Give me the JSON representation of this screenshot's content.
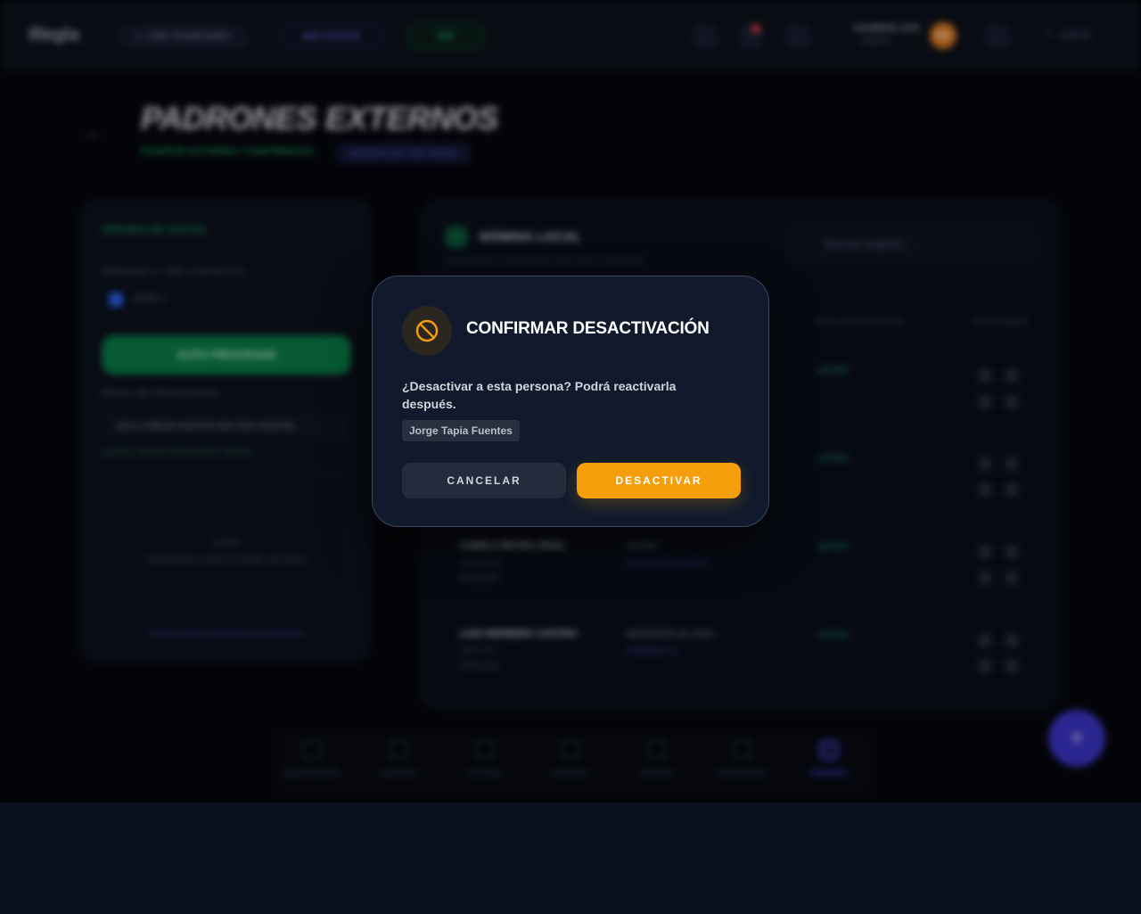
{
  "header": {
    "logo": "Illegla",
    "pill_1": "VER PADRONES",
    "pill_2": "MIS DATOS",
    "pill_3": "VIP",
    "user_name": "NOMBRE APE",
    "user_role": "ADMIN",
    "avatar_initials": "NA",
    "logout_label": "SALIR"
  },
  "page": {
    "title": "PADRONES EXTERNOS",
    "tag_1": "PADRÓN EXTERNO CONFIRMADO",
    "tag_2": "MODIFICAR VER NODO"
  },
  "left_panel": {
    "heading": "ORIGEN DE DATOS",
    "contact_label": "PERIODO O VER CONTACTO",
    "checkbox_label": "DATA 1",
    "primary_button": "AUTO PROCESAR",
    "section_label": "MODO DE PROCESADO",
    "select_value": "SOLO CREAR NUEVOS (NO PISA EXISTE)",
    "hint": "ALERTA: NUNCA PISAR DATOS VIEJOS.",
    "drop_title": "SUBIR",
    "drop_subtitle": "ARRASTRE O SELECCIONE ARCHIVO",
    "footer_link": "CONSULTAR FORMATO DE ARCHIVO"
  },
  "right_panel": {
    "title": "NÓMINA LOCAL",
    "subtitle": "PERSONAS CARGADAS EN ESTE PADRÓN",
    "search_placeholder": "Buscar registro...",
    "col_contacts": "VER CONTACTOS",
    "col_actions": "ACCIONES",
    "rows": [
      {
        "name": "",
        "id": "",
        "sub": "",
        "role": "",
        "link": "",
        "badge": "ACTIVO"
      },
      {
        "name": "",
        "id": "",
        "sub": "",
        "role": "",
        "link": "",
        "badge": "ACTIVO"
      },
      {
        "name": "CAMILA REYES VIDAL",
        "id": "10.442.983",
        "sub": "PERSONA",
        "role": "VECINO",
        "link": "REFERENTE BARRIO",
        "badge": "ACTIVO"
      },
      {
        "name": "LUIS HERRERA CASTRO",
        "id": "8.907.221",
        "sub": "PERSONA",
        "role": "REFERENTE DE ZONA",
        "link": "MANZANA 14",
        "badge": "ACTIVO"
      }
    ]
  },
  "bottom_nav": [
    {
      "label": "DASHBOARD"
    },
    {
      "label": "AGENDA"
    },
    {
      "label": "FICHAS"
    },
    {
      "label": "GRUPOS"
    },
    {
      "label": "ENVÍOS"
    },
    {
      "label": "REPORTES"
    },
    {
      "label": "PADRÓN"
    }
  ],
  "modal": {
    "icon": "ban-icon",
    "title": "CONFIRMAR DESACTIVACIÓN",
    "message": "¿Desactivar a esta persona? Podrá reactivarla después.",
    "person_name": "Jorge Tapia Fuentes",
    "cancel_label": "CANCELAR",
    "confirm_label": "DESACTIVAR",
    "accent_color": "#f59e0b"
  }
}
